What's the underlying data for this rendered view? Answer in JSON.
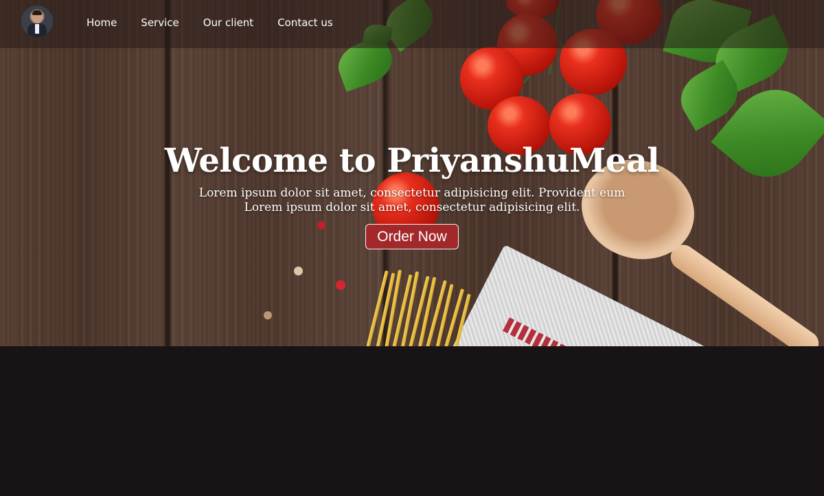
{
  "nav": {
    "avatar_alt": "profile",
    "links": [
      "Home",
      "Service",
      "Our client",
      "Contact us"
    ]
  },
  "hero": {
    "title": "Welcome to PriyanshuMeal",
    "text_line1": "Lorem ipsum dolor sit amet, consectetur adipisicing elit. Provident eum",
    "text_line2": "Lorem ipsum dolor sit amet, consectetur adipisicing elit.",
    "button_label": "Order Now"
  },
  "colors": {
    "button_bg": "#a2282a",
    "page_bg": "#181314",
    "navbar_bg": "rgba(40,28,24,0.55)"
  }
}
